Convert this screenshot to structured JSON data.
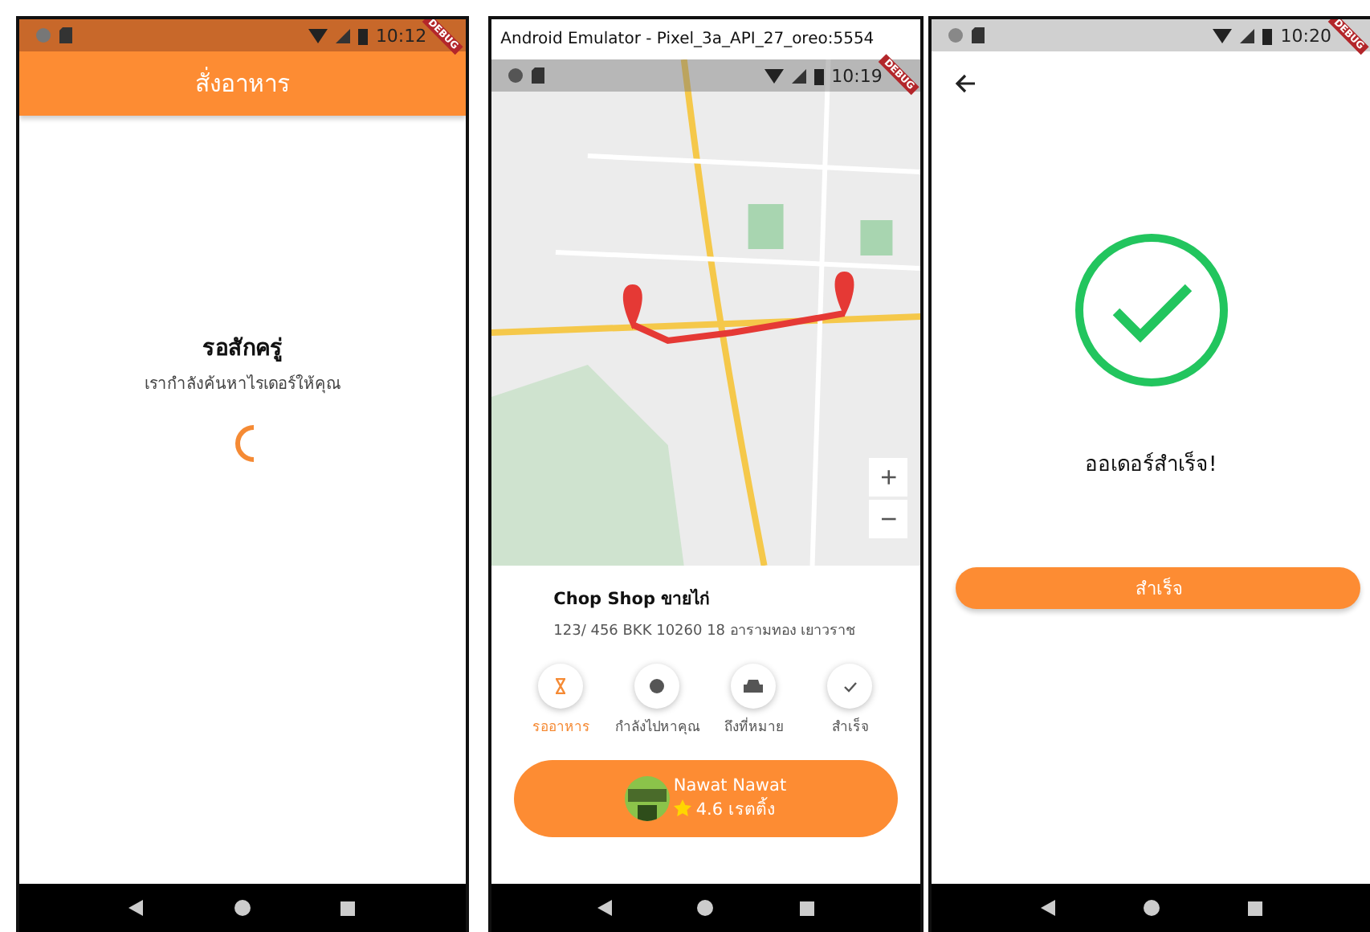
{
  "waiting_screen": {
    "status_time": "10:12",
    "debug_banner": "DEBUG",
    "app_bar_title": "สั่งอาหาร",
    "title": "รอสักครู่",
    "message": "เรากำลังค้นหาไรเดอร์ให้คุณ"
  },
  "tracking_screen": {
    "window_title": "Android Emulator - Pixel_3a_API_27_oreo:5554",
    "status_time": "10:19",
    "debug_banner": "DEBUG",
    "map_controls": [
      "+",
      "−"
    ],
    "shop_name": "Chop Shop ขายไก่",
    "address": "123/ 456 BKK 10260 18 อารามทอง เยาวราช",
    "steps": [
      {
        "label": "รออาหาร",
        "selected": true
      },
      {
        "label": "กำลังไปหาคุณ",
        "selected": false
      },
      {
        "label": "ถึงที่หมาย",
        "selected": false
      },
      {
        "label": "สำเร็จ",
        "selected": false
      }
    ],
    "driver": {
      "name": "Nawat Nawat",
      "rating": "4.6 เรตติ้ง"
    }
  },
  "success_screen": {
    "status_time": "10:20",
    "debug_banner": "DEBUG",
    "message": "ออเดอร์สำเร็จ!",
    "button": "สำเร็จ"
  }
}
